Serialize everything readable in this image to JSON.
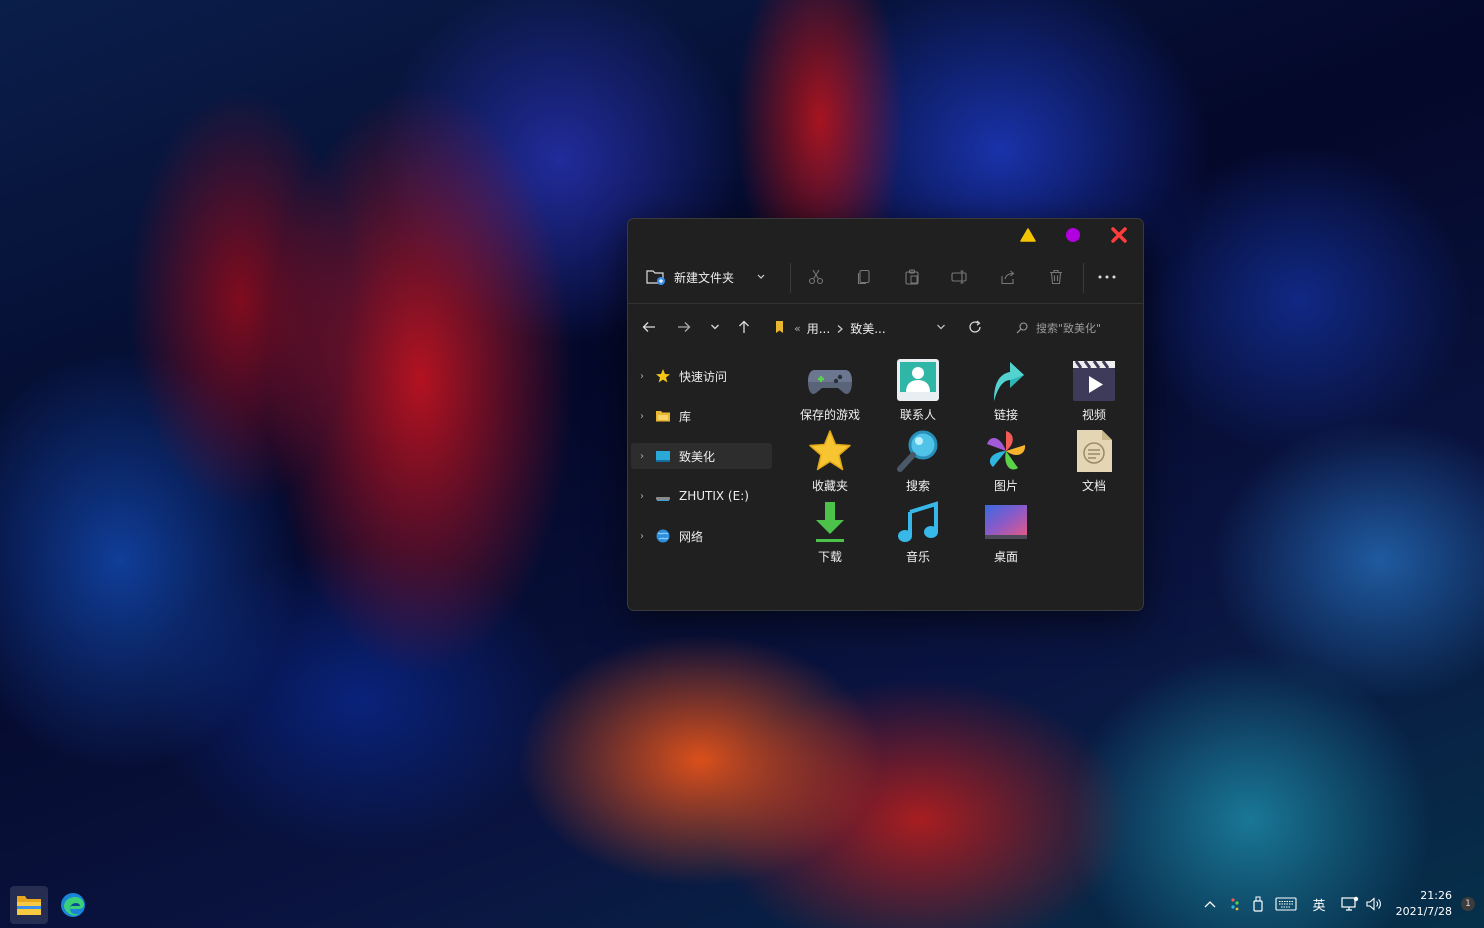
{
  "window": {
    "toolbar": {
      "new_folder_label": "新建文件夹"
    },
    "address": {
      "overflow_marker": "«",
      "crumbs": [
        "用...",
        "致美..."
      ],
      "search_placeholder": "搜索\"致美化\""
    },
    "sidebar": {
      "items": [
        {
          "label": "快速访问",
          "icon": "star-icon"
        },
        {
          "label": "库",
          "icon": "library-folder-icon"
        },
        {
          "label": "致美化",
          "icon": "desktop-icon",
          "selected": true
        },
        {
          "label": "ZHUTIX (E:)",
          "icon": "drive-icon"
        },
        {
          "label": "网络",
          "icon": "network-globe-icon"
        }
      ]
    },
    "folders": [
      {
        "label": "保存的游戏",
        "icon": "gamepad-icon"
      },
      {
        "label": "联系人",
        "icon": "contacts-icon"
      },
      {
        "label": "链接",
        "icon": "link-arrow-icon"
      },
      {
        "label": "视频",
        "icon": "video-icon"
      },
      {
        "label": "收藏夹",
        "icon": "favorites-star-icon"
      },
      {
        "label": "搜索",
        "icon": "search-magnifier-icon"
      },
      {
        "label": "图片",
        "icon": "pictures-pinwheel-icon"
      },
      {
        "label": "文档",
        "icon": "document-icon"
      },
      {
        "label": "下载",
        "icon": "download-arrow-icon"
      },
      {
        "label": "音乐",
        "icon": "music-note-icon"
      },
      {
        "label": "桌面",
        "icon": "desktop-folder-icon"
      }
    ]
  },
  "colors": {
    "minimize": "#f5c400",
    "maximize": "#b000e0",
    "close": "#ff3b3b",
    "window_bg": "#202020"
  },
  "taskbar": {
    "apps": [
      {
        "name": "file-explorer",
        "active": true
      },
      {
        "name": "edge-browser",
        "active": false
      }
    ],
    "ime_label": "英",
    "time": "21:26",
    "date": "2021/7/28",
    "notification_count": "1"
  }
}
